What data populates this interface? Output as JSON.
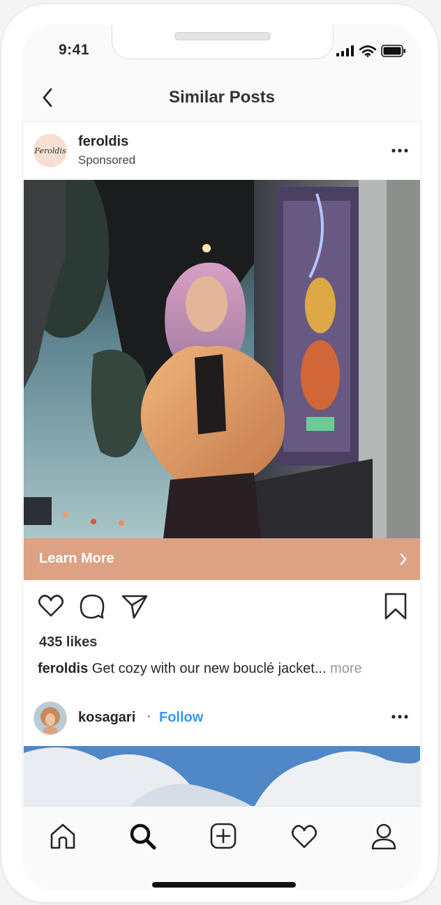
{
  "status_bar": {
    "time": "9:41"
  },
  "nav": {
    "title": "Similar Posts",
    "back_icon": "chevron-left-icon"
  },
  "post": {
    "username": "feroldis",
    "subtitle": "Sponsored",
    "avatar_text": "Feroldis",
    "cta_label": "Learn More",
    "cta_color": "#dda283",
    "likes": "435 likes",
    "caption_user": "feroldis",
    "caption_text": " Get cozy with our new bouclé jacket...",
    "caption_more": " more"
  },
  "next_post": {
    "username": "kosagari",
    "separator": "·",
    "follow_label": "Follow",
    "follow_color": "#3897f0"
  },
  "tab_bar": {
    "items": [
      "home-icon",
      "search-icon",
      "add-post-icon",
      "activity-heart-icon",
      "profile-icon"
    ],
    "active": "search-icon"
  }
}
